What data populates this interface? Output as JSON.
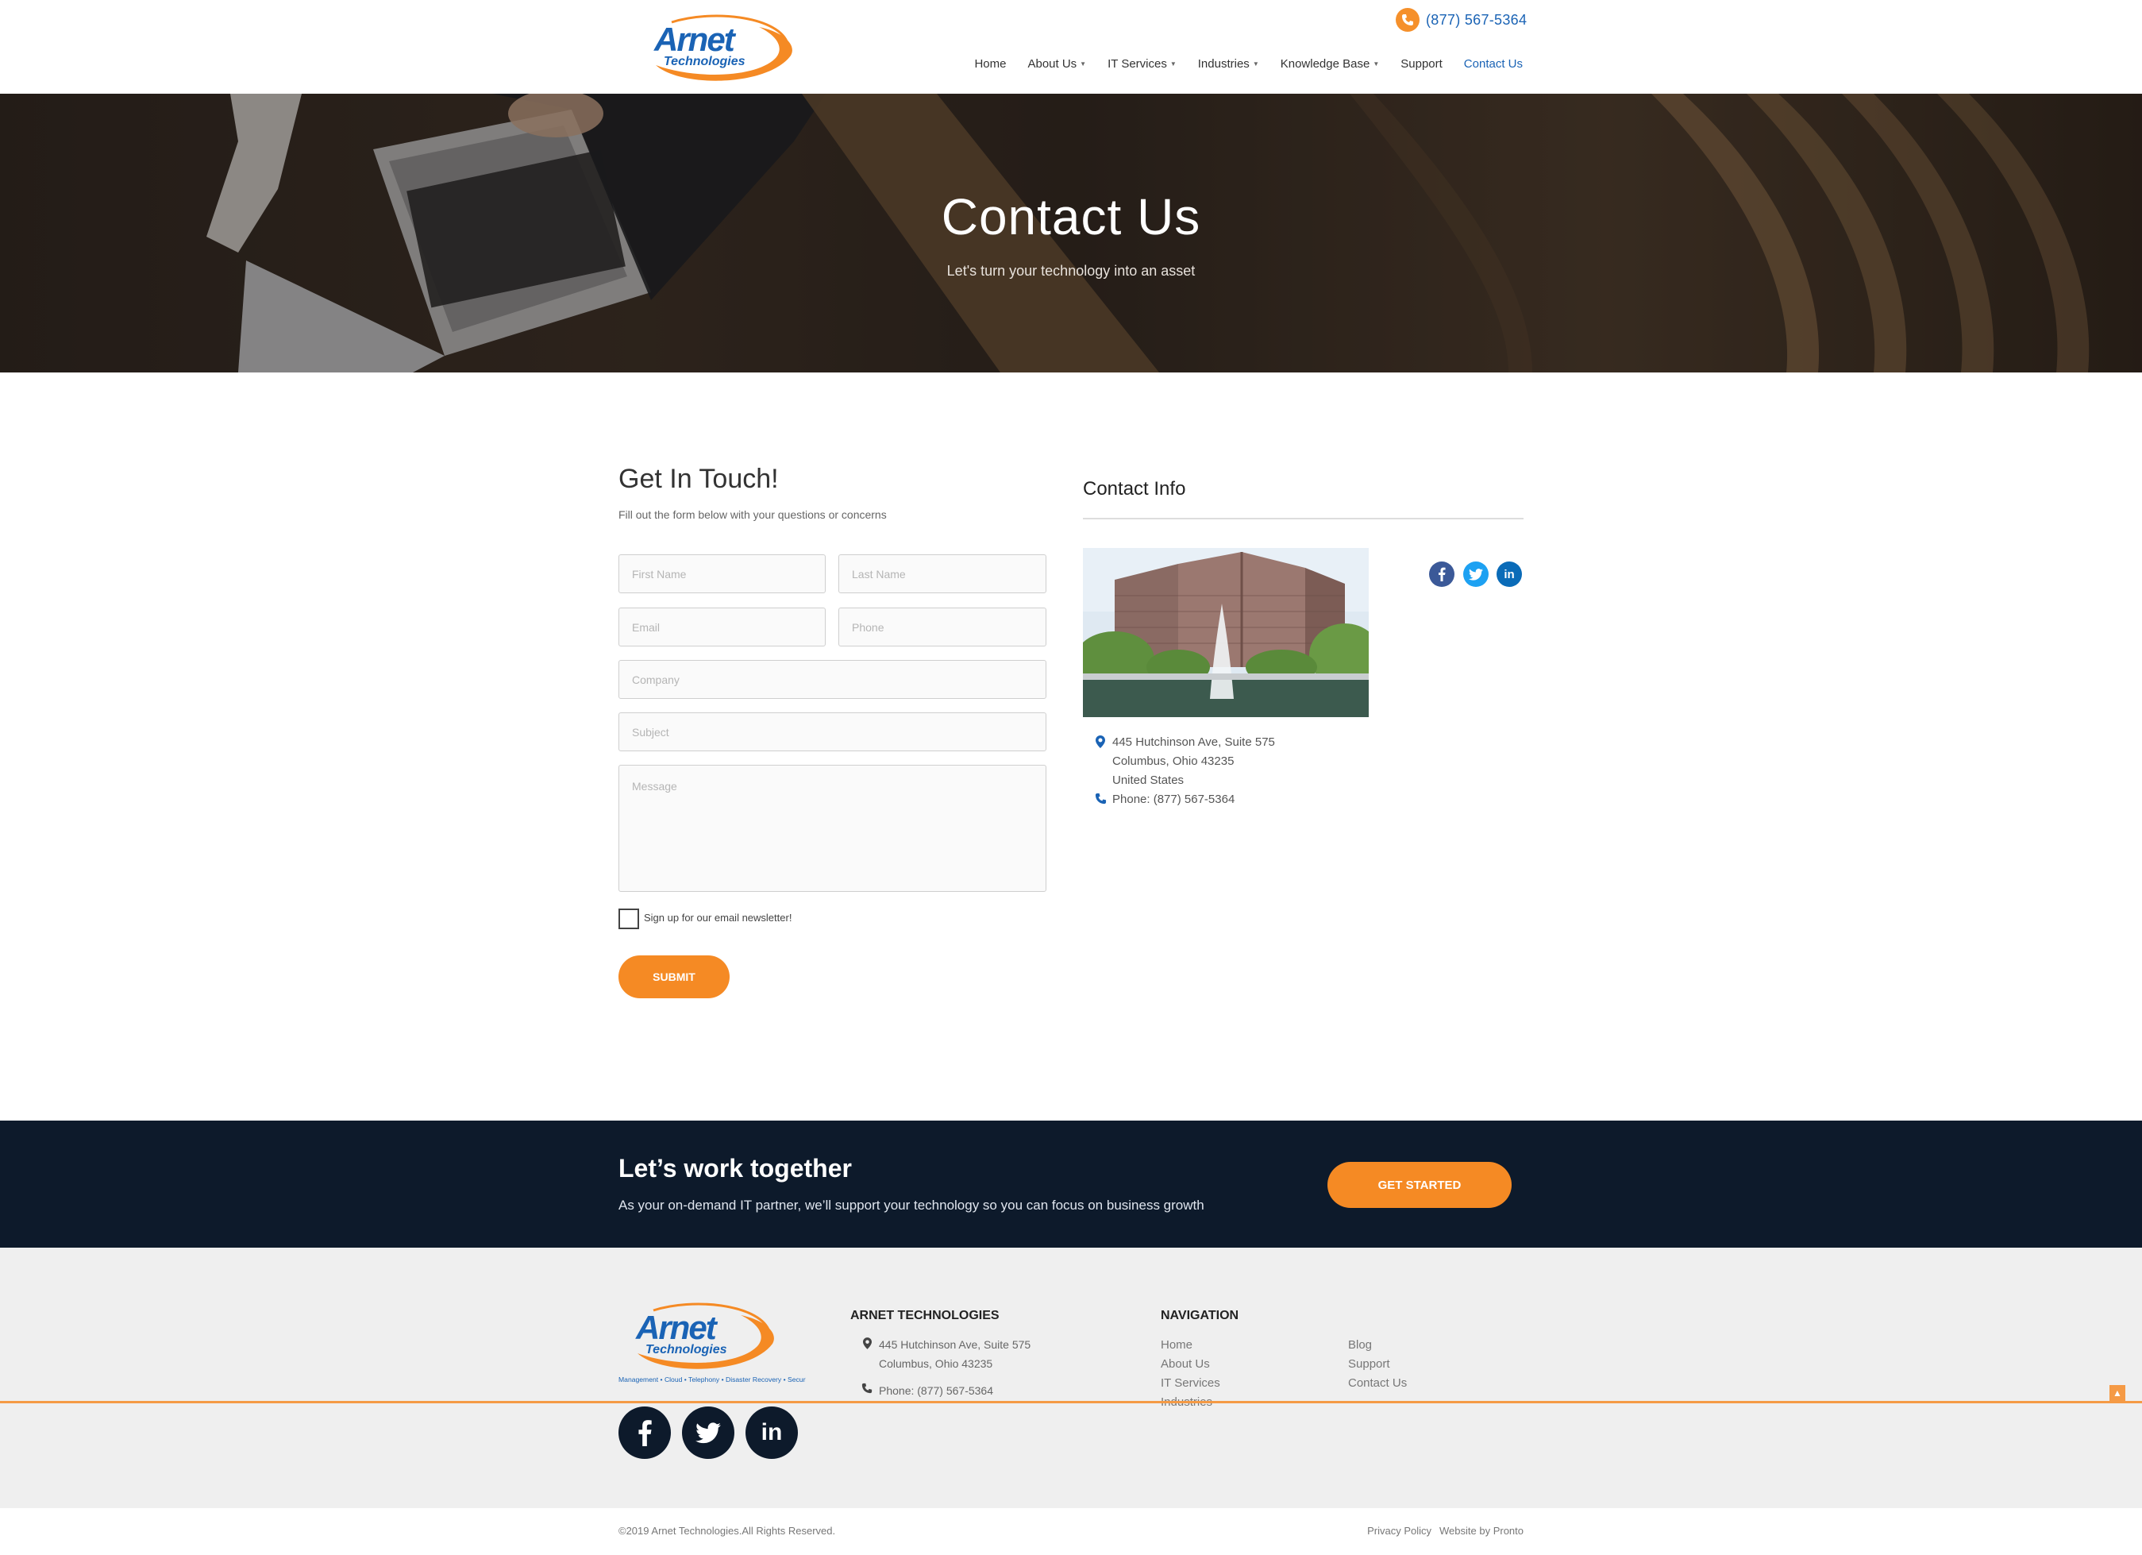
{
  "header": {
    "logo_main": "Arnet",
    "logo_sub": "Technologies",
    "phone": "(877) 567-5364",
    "nav": [
      {
        "label": "Home",
        "dropdown": false
      },
      {
        "label": "About Us",
        "dropdown": true
      },
      {
        "label": "IT Services",
        "dropdown": true
      },
      {
        "label": "Industries",
        "dropdown": true
      },
      {
        "label": "Knowledge Base",
        "dropdown": true
      },
      {
        "label": "Support",
        "dropdown": false
      },
      {
        "label": "Contact Us",
        "dropdown": false,
        "active": true
      }
    ]
  },
  "hero": {
    "title": "Contact Us",
    "subtitle": "Let's turn your technology into an asset"
  },
  "form": {
    "title": "Get In Touch!",
    "subtitle": "Fill out the form below with your questions or concerns",
    "first_name_placeholder": "First Name",
    "last_name_placeholder": "Last Name",
    "email_placeholder": "Email",
    "phone_placeholder": "Phone",
    "company_placeholder": "Company",
    "subject_placeholder": "Subject",
    "message_placeholder": "Message",
    "newsletter_label": "Sign up for our email newsletter!",
    "newsletter_checked": false,
    "submit_label": "SUBMIT"
  },
  "contact_info": {
    "title": "Contact Info",
    "address_line1": "445 Hutchinson Ave, Suite 575",
    "address_line2": "Columbus, Ohio 43235",
    "address_line3": "United States",
    "phone": "Phone: (877) 567-5364",
    "socials": [
      "facebook-icon",
      "twitter-icon",
      "linkedin-icon"
    ]
  },
  "cta": {
    "title": "Let’s work together",
    "subtitle": "As your on-demand IT partner, we’ll support your technology so you can focus on business growth",
    "button": "GET STARTED"
  },
  "footer": {
    "logo_main": "Arnet",
    "logo_sub": "Technologies",
    "logo_tagline": "Management • Cloud • Telephony • Disaster Recovery • Security",
    "company_heading": "ARNET TECHNOLOGIES",
    "address_line1": "445 Hutchinson Ave, Suite 575",
    "address_line2": "Columbus, Ohio 43235",
    "phone": "Phone: (877) 567-5364",
    "nav_heading": "NAVIGATION",
    "nav_col1": [
      "Home",
      "About Us",
      "IT Services",
      "Industries"
    ],
    "nav_col2": [
      "Blog",
      "Support",
      "Contact Us"
    ],
    "copyright": "©2019 Arnet Technologies.All Rights Reserved.",
    "privacy": "Privacy Policy",
    "credit": "Website by Pronto"
  },
  "colors": {
    "brand_blue": "#1a63b5",
    "brand_orange": "#f58a24",
    "navy": "#0d1a2b"
  }
}
